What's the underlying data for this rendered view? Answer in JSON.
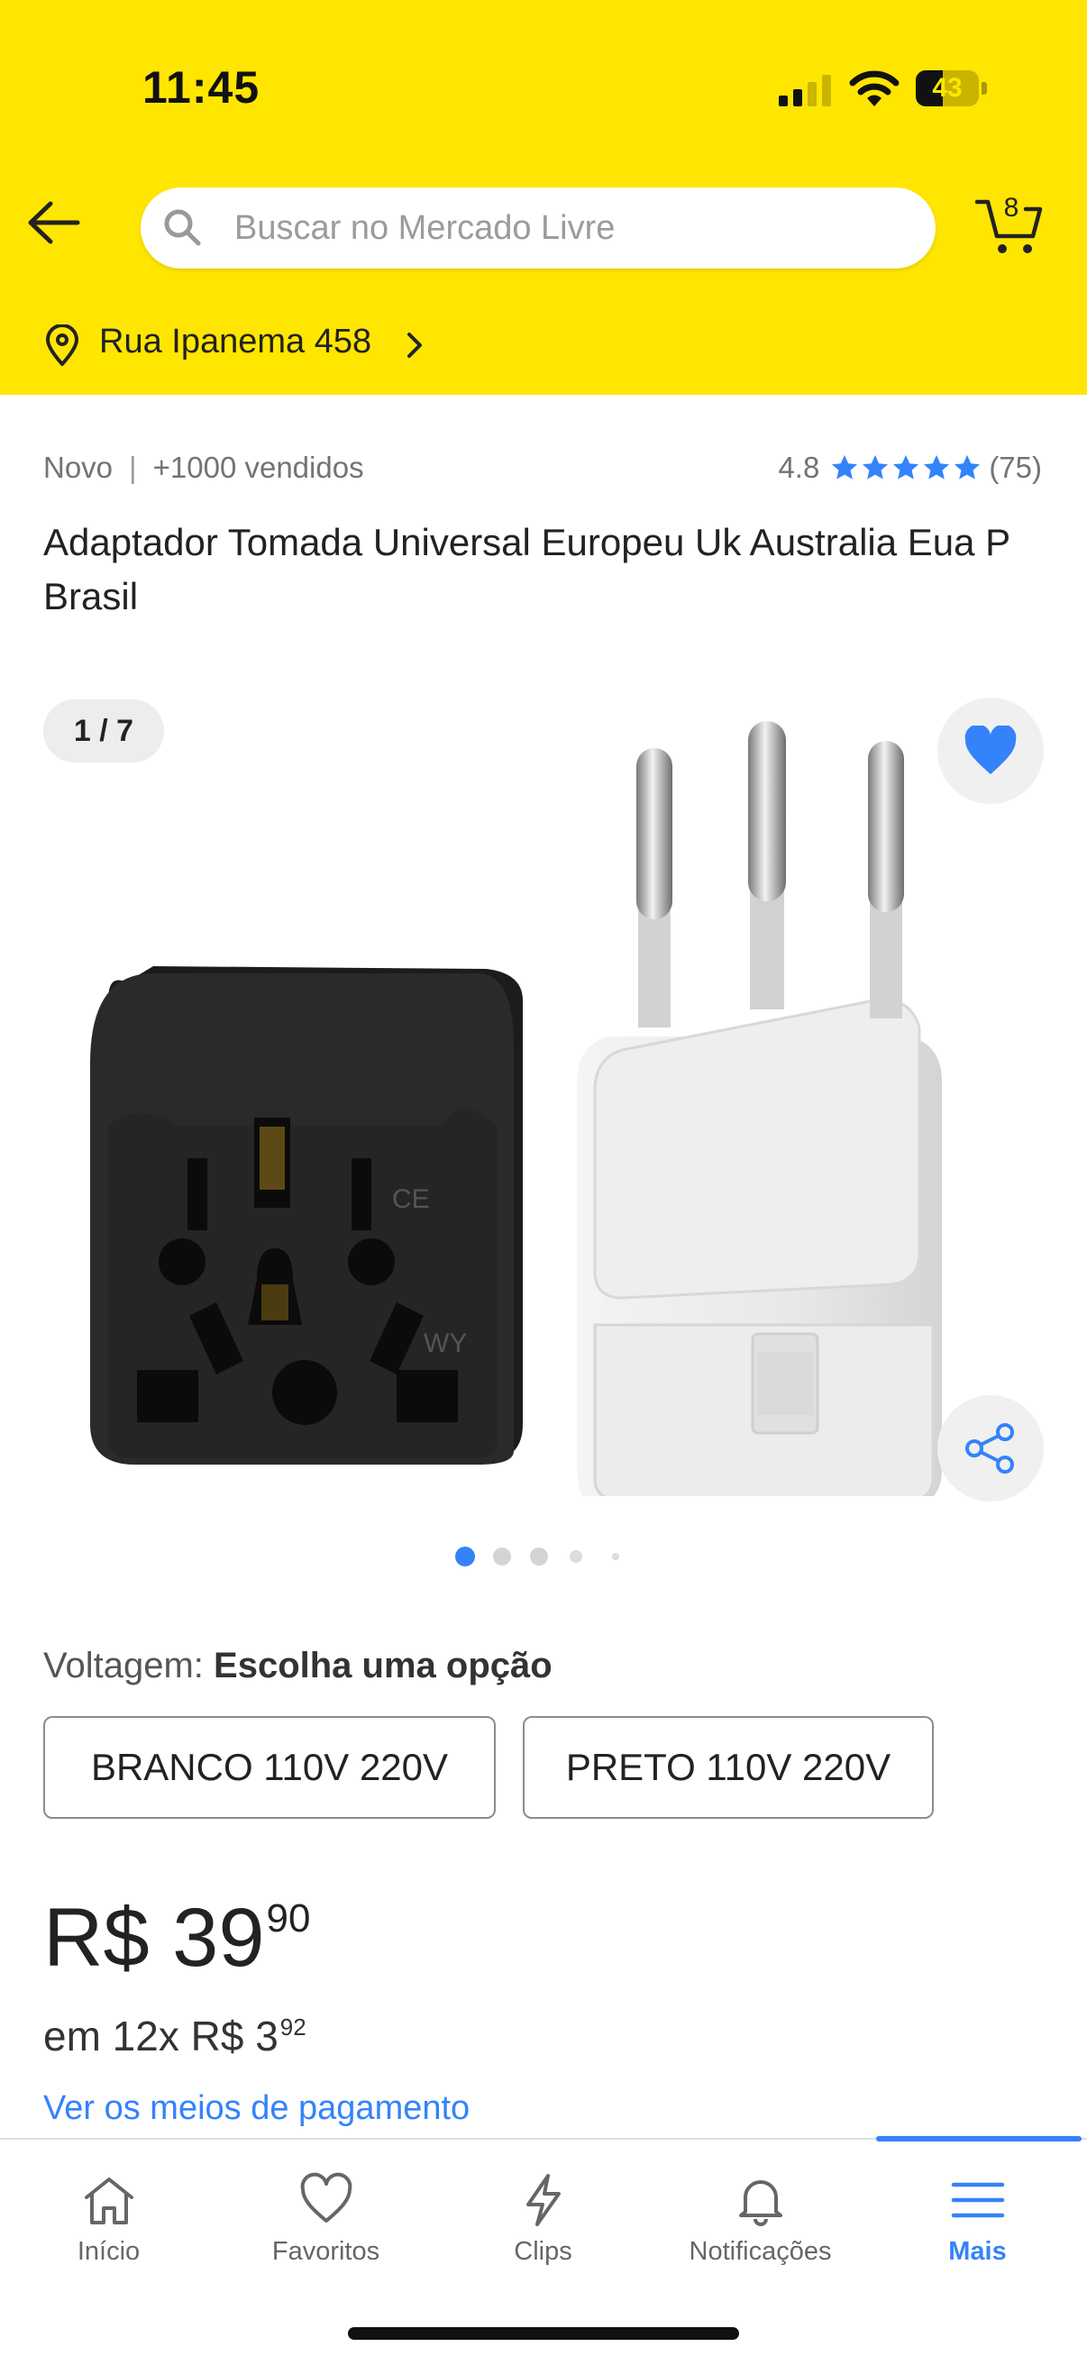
{
  "status_bar": {
    "time": "11:45",
    "battery": "43",
    "battery_level": 0.43
  },
  "header": {
    "search_placeholder": "Buscar no Mercado Livre",
    "cart_count": "8",
    "location": "Rua Ipanema 458",
    "background_color": "#ffe600"
  },
  "product": {
    "condition": "Novo",
    "separator": "|",
    "sold": "+1000 vendidos",
    "rating": "4.8",
    "rating_stars": 5,
    "reviews": "(75)",
    "title": "Adaptador Tomada Universal Europeu Uk Australia Eua P Brasil",
    "image_counter": "1 / 7"
  },
  "variations": {
    "label": "Voltagem:",
    "value": "Escolha uma opção",
    "options": [
      "BRANCO 110V 220V",
      "PRETO 110V 220V"
    ]
  },
  "price": {
    "currency": "R$",
    "integer": "39",
    "cents": "90",
    "installments_prefix": "em 12x R$ 3",
    "installments_cents": "92",
    "payment_link": "Ver os meios de pagamento"
  },
  "tabs": [
    {
      "label": "Início",
      "icon": "home-icon"
    },
    {
      "label": "Favoritos",
      "icon": "heart-icon"
    },
    {
      "label": "Clips",
      "icon": "bolt-icon"
    },
    {
      "label": "Notificações",
      "icon": "bell-icon"
    },
    {
      "label": "Mais",
      "icon": "menu-icon",
      "active": true
    }
  ],
  "colors": {
    "accent": "#3483fa",
    "brand_yellow": "#ffe600"
  }
}
